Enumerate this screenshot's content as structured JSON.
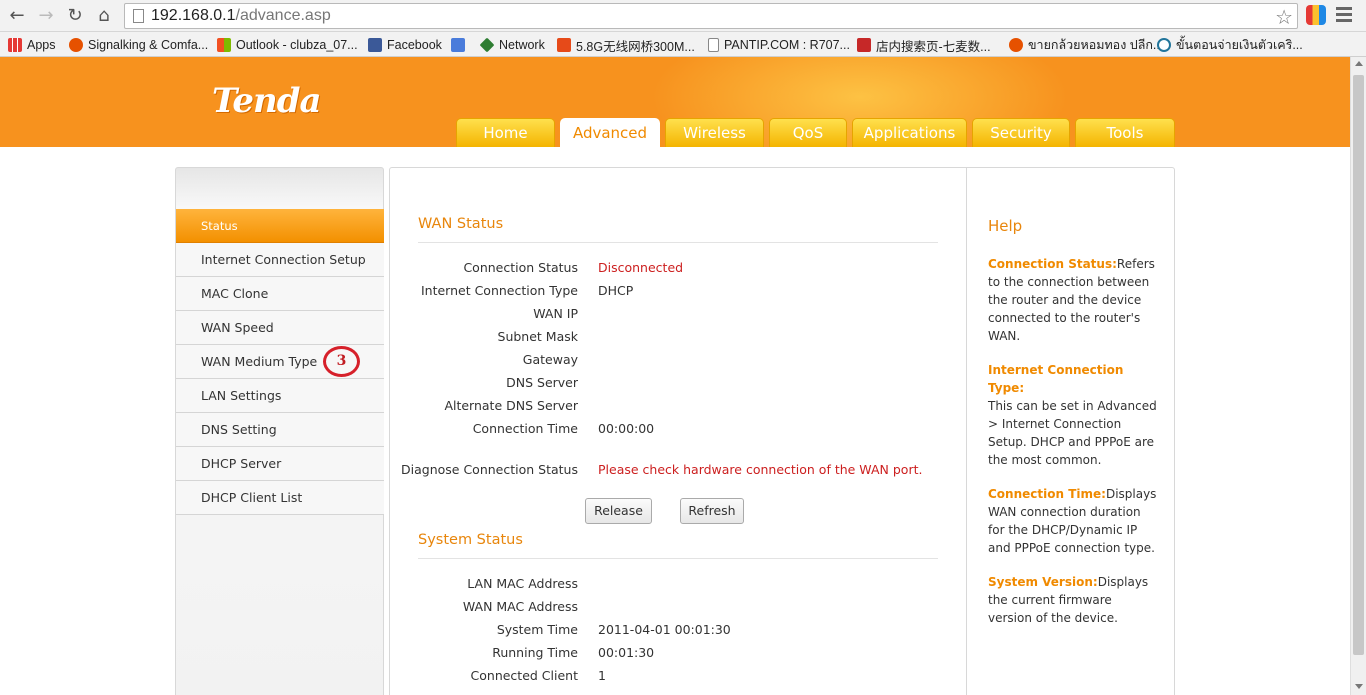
{
  "browser": {
    "url_host": "192.168.0.1",
    "url_path": "/advance.asp",
    "bookmarks": [
      {
        "label": "Apps",
        "icon": "apps-grid-icon"
      },
      {
        "label": "Signalking & Comfa...",
        "icon": "site-favicon-icon"
      },
      {
        "label": "Outlook - clubza_07...",
        "icon": "windows-logo-icon"
      },
      {
        "label": "Facebook",
        "icon": "facebook-icon"
      },
      {
        "label": "",
        "icon": "google-icon"
      },
      {
        "label": "Network",
        "icon": "network-diamond-icon"
      },
      {
        "label": "5.8G无线网桥300M...",
        "icon": "site-favicon-icon"
      },
      {
        "label": "PANTIP.COM : R707...",
        "icon": "page-icon"
      },
      {
        "label": "店内搜索页-七麦数...",
        "icon": "t-logo-icon"
      },
      {
        "label": "ขายกล้วยหอมทอง ปลีก...",
        "icon": "site-favicon-icon"
      },
      {
        "label": "ขั้นตอนจ่ายเงินตัวเคริ...",
        "icon": "wordpress-icon"
      }
    ]
  },
  "header": {
    "logo": "Tenda",
    "tabs": [
      "Home",
      "Advanced",
      "Wireless",
      "QoS",
      "Applications",
      "Security",
      "Tools"
    ],
    "active_tab": "Advanced"
  },
  "sidebar": {
    "items": [
      "Status",
      "Internet Connection Setup",
      "MAC Clone",
      "WAN Speed",
      "WAN Medium Type",
      "LAN Settings",
      "DNS Setting",
      "DHCP Server",
      "DHCP Client List"
    ],
    "active": "Status",
    "annotation": "3"
  },
  "wan_status": {
    "title": "WAN Status",
    "rows": [
      {
        "label": "Connection Status",
        "value": "Disconnected"
      },
      {
        "label": "Internet Connection Type",
        "value": "DHCP"
      },
      {
        "label": "WAN IP",
        "value": ""
      },
      {
        "label": "Subnet Mask",
        "value": ""
      },
      {
        "label": "Gateway",
        "value": ""
      },
      {
        "label": "DNS Server",
        "value": ""
      },
      {
        "label": "Alternate DNS Server",
        "value": ""
      },
      {
        "label": "Connection Time",
        "value": "00:00:00"
      }
    ],
    "diagnose_label": "Diagnose Connection Status",
    "diagnose_value": "Please check hardware connection of the WAN port.",
    "release_label": "Release",
    "refresh_label": "Refresh"
  },
  "system_status": {
    "title": "System Status",
    "rows": [
      {
        "label": "LAN MAC Address",
        "value": ""
      },
      {
        "label": "WAN MAC Address",
        "value": ""
      },
      {
        "label": "System Time",
        "value": "2011-04-01 00:01:30"
      },
      {
        "label": "Running Time",
        "value": "00:01:30"
      },
      {
        "label": "Connected Client",
        "value": "1"
      }
    ]
  },
  "help": {
    "title": "Help",
    "blocks": [
      {
        "key": "Connection Status:",
        "text": "Refers to the connection between the router and the device connected to the router's WAN."
      },
      {
        "key": "Internet Connection Type:",
        "text": "This can be set in Advanced > Internet Connection Setup. DHCP and PPPoE are the most common."
      },
      {
        "key": "Connection Time:",
        "text": "Displays WAN connection duration for the DHCP/Dynamic IP and PPPoE connection type."
      },
      {
        "key": "System Version:",
        "text": "Displays the current firmware version of the device."
      }
    ]
  },
  "colors": {
    "header_orange": "#f7921e",
    "accent_orange": "#e8860c",
    "error_red": "#cc1f1f",
    "annotation_red": "#d6202a"
  }
}
